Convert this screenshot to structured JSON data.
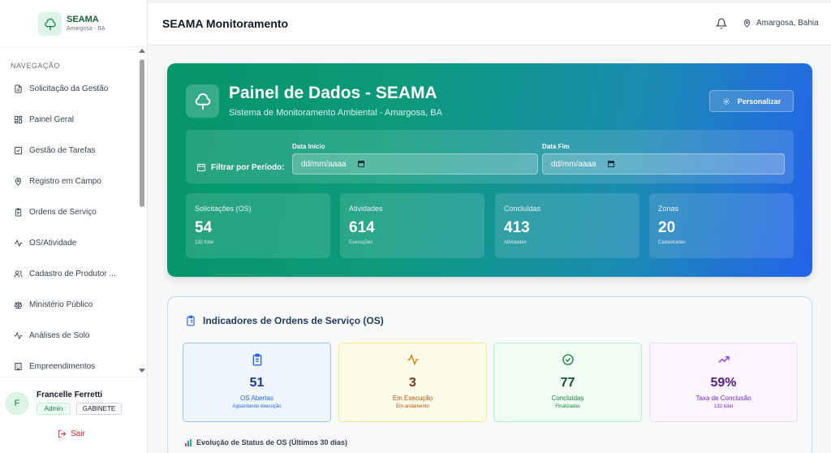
{
  "brand": {
    "title": "SEAMA",
    "subtitle": "Amargosa - BA"
  },
  "sidebar": {
    "heading": "NAVEGAÇÃO",
    "items": [
      {
        "label": "Solicitação da Gestão",
        "icon": "document-icon"
      },
      {
        "label": "Painel Geral",
        "icon": "dashboard-grid-icon"
      },
      {
        "label": "Gestão de Tarefas",
        "icon": "checkbox-icon"
      },
      {
        "label": "Registro em Campo",
        "icon": "map-pin-icon"
      },
      {
        "label": "Ordens de Serviço",
        "icon": "clipboard-icon"
      },
      {
        "label": "OS/Atividade",
        "icon": "activity-icon"
      },
      {
        "label": "Cadastro de Produtor ...",
        "icon": "users-icon"
      },
      {
        "label": "Ministério Público",
        "icon": "scale-icon"
      },
      {
        "label": "Análises de Solo",
        "icon": "activity-icon"
      },
      {
        "label": "Empreendimentos",
        "icon": "building-icon"
      }
    ]
  },
  "user": {
    "initial": "F",
    "name": "Francelle Ferretti",
    "role": "Admin",
    "department": "GABINETE",
    "logout_label": "Sair"
  },
  "header": {
    "title": "SEAMA Monitoramento",
    "location": "Amargosa, Bahia"
  },
  "hero": {
    "title": "Painel de Dados - SEAMA",
    "subtitle": "Sistema de Monitoramento Ambiental - Amargosa, BA",
    "customize_label": "Personalizar",
    "filter_label": "Filtrar por Período:",
    "start_label": "Data Início",
    "start_placeholder": "dd/mm/aaaa",
    "end_label": "Data Fim",
    "end_placeholder": "dd/mm/aaaa",
    "stats": [
      {
        "label": "Solicitações (OS)",
        "value": "54",
        "sub": "132 total"
      },
      {
        "label": "Atividades",
        "value": "614",
        "sub": "Execuções"
      },
      {
        "label": "Concluídas",
        "value": "413",
        "sub": "Atividades"
      },
      {
        "label": "Zonas",
        "value": "20",
        "sub": "Cadastradas"
      }
    ]
  },
  "indicators": {
    "title": "Indicadores de Ordens de Serviço (OS)",
    "cards": [
      {
        "value": "51",
        "label": "OS Abertas",
        "sub": "Aguardando execução",
        "icon": "clipboard-icon"
      },
      {
        "value": "3",
        "label": "Em Execução",
        "sub": "Em andamento",
        "icon": "activity-icon"
      },
      {
        "value": "77",
        "label": "Concluídas",
        "sub": "Finalizadas",
        "icon": "check-circle-icon"
      },
      {
        "value": "59%",
        "label": "Taxa de Conclusão",
        "sub": "132 total",
        "icon": "trending-up-icon"
      }
    ],
    "evolution_title": "Evolução de Status de OS (Últimos 30 dias)"
  },
  "colors": {
    "primary_green": "#059669",
    "primary_blue": "#2563eb",
    "danger": "#dc2626"
  }
}
